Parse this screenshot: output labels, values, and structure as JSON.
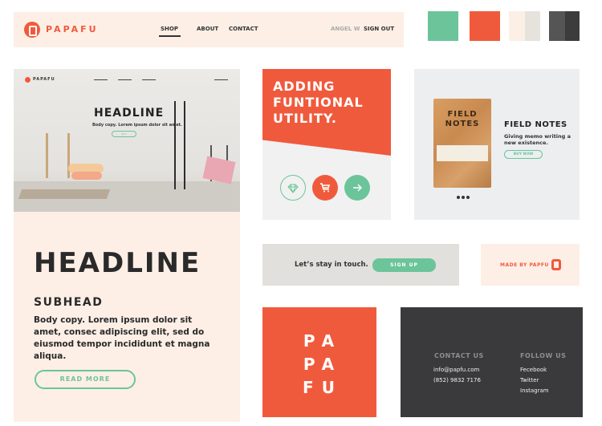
{
  "nav": {
    "logo": "PAPAFU",
    "links": [
      "SHOP",
      "ABOUT",
      "CONTACT"
    ],
    "user": "ANGEL W",
    "sign_out": "SIGN OUT"
  },
  "swatches": {
    "green": "#6cc49a",
    "red": "#f05a3c",
    "cream": [
      "#fbefe6",
      "#e6e3dd"
    ],
    "dark": [
      "#555555",
      "#3c3c3c"
    ]
  },
  "hero": {
    "mini_logo": "PAPAFU",
    "photo_headline": "HEADLINE",
    "photo_copy": "Body copy. Lorem ipsum dolor sit amet.",
    "photo_button": "BUY",
    "headline": "HEADLINE",
    "subhead": "SUBHEAD",
    "body": "Body copy. Lorem ipsum dolor sit amet, consec adipiscing elit, sed do eiusmod tempor incididunt et magna aliqua.",
    "button": "READ MORE"
  },
  "utility": {
    "title": "ADDING FUNTIONAL UTILITY.",
    "icons": [
      "diamond-icon",
      "cart-icon",
      "arrow-right-icon"
    ]
  },
  "notes": {
    "notebook_title": "FIELD NOTES",
    "title": "FIELD NOTES",
    "description": "Giving memo writing a new existence.",
    "button": "BUY NOW"
  },
  "newsletter": {
    "text": "Let’s stay in touch.",
    "button": "SIGN UP"
  },
  "made_by": {
    "text": "MADE BY PAPFU"
  },
  "brand_block": {
    "lines": [
      "PA",
      "PA",
      "FU"
    ]
  },
  "footer": {
    "contact_head": "CONTACT US",
    "email": "info@papfu.com",
    "phone": "(852) 9832 7176",
    "follow_head": "FOLLOW US",
    "social": [
      "Fecebook",
      "Twitter",
      "Instagram"
    ]
  }
}
